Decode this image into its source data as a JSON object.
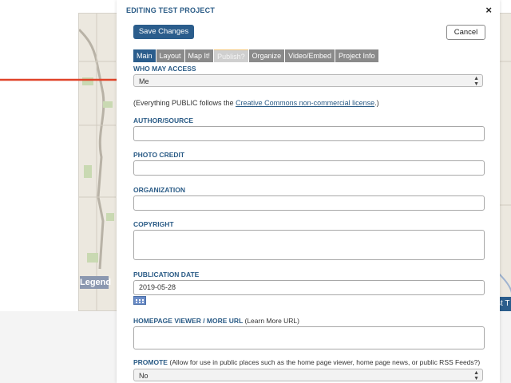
{
  "modal": {
    "title": "EDITING TEST PROJECT",
    "close_glyph": "×",
    "save_label": "Save Changes",
    "cancel_label": "Cancel"
  },
  "tabs": [
    {
      "label": "Main",
      "state": "active"
    },
    {
      "label": "Layout",
      "state": "normal"
    },
    {
      "label": "Map It!",
      "state": "normal"
    },
    {
      "label": "Publish?",
      "state": "disabled"
    },
    {
      "label": "Organize",
      "state": "normal"
    },
    {
      "label": "Video/Embed",
      "state": "normal"
    },
    {
      "label": "Project Info",
      "state": "normal"
    }
  ],
  "access": {
    "label": "WHO MAY ACCESS",
    "value": "Me",
    "note_prefix": "(Everything PUBLIC follows the ",
    "note_link": "Creative Commons non-commercial license",
    "note_suffix": ".)"
  },
  "fields": {
    "author": {
      "label": "AUTHOR/SOURCE",
      "value": ""
    },
    "photo_credit": {
      "label": "PHOTO CREDIT",
      "value": ""
    },
    "organization": {
      "label": "ORGANIZATION",
      "value": ""
    },
    "copyright": {
      "label": "COPYRIGHT",
      "value": ""
    },
    "publication_date": {
      "label": "PUBLICATION DATE",
      "value": "2019-05-28"
    },
    "homepage_url": {
      "label": "HOMEPAGE VIEWER / MORE URL",
      "note": "(Learn More URL)",
      "value": ""
    },
    "promote": {
      "label": "PROMOTE",
      "note": "(Allow for use in public places such as the home page viewer, home page news, or public RSS Feeds?)",
      "value": "No"
    }
  },
  "background": {
    "legend_label": "Legend",
    "right_button_label": "st T"
  },
  "icons": {
    "calendar": "calendar-icon",
    "arrow": "arrow-right-icon",
    "select_caret": "up-down-caret-icon"
  },
  "colors": {
    "primary": "#2b5d8c",
    "label": "#2a5b86",
    "arrow": "#e0442a",
    "tab_inactive": "#8a8a8a"
  }
}
